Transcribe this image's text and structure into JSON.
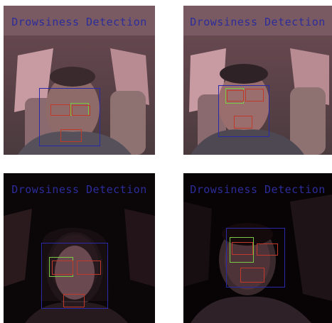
{
  "panels": [
    {
      "overlay_text": "Drowsiness Detection",
      "scene": "daylight",
      "face_box_color": "#2a2aa8",
      "eye_box_color": "#c0392b",
      "eye_box_alt_color": "#7ac943",
      "mouth_box_color": "#c0392b"
    },
    {
      "overlay_text": "Drowsiness Detection",
      "scene": "daylight",
      "face_box_color": "#2a2aa8",
      "eye_box_color": "#c0392b",
      "eye_box_alt_color": "#7ac943",
      "mouth_box_color": "#c0392b"
    },
    {
      "overlay_text": "Drowsiness Detection",
      "scene": "night",
      "face_box_color": "#2a2aa8",
      "eye_box_color": "#c0392b",
      "eye_box_alt_color": "#7ac943",
      "mouth_box_color": "#c0392b"
    },
    {
      "overlay_text": "Drowsiness Detection",
      "scene": "night",
      "face_box_color": "#2a2aa8",
      "eye_box_color": "#c0392b",
      "eye_box_alt_color": "#7ac943",
      "mouth_box_color": "#c0392b"
    }
  ],
  "overlay_text_color": "#2c2c9a"
}
